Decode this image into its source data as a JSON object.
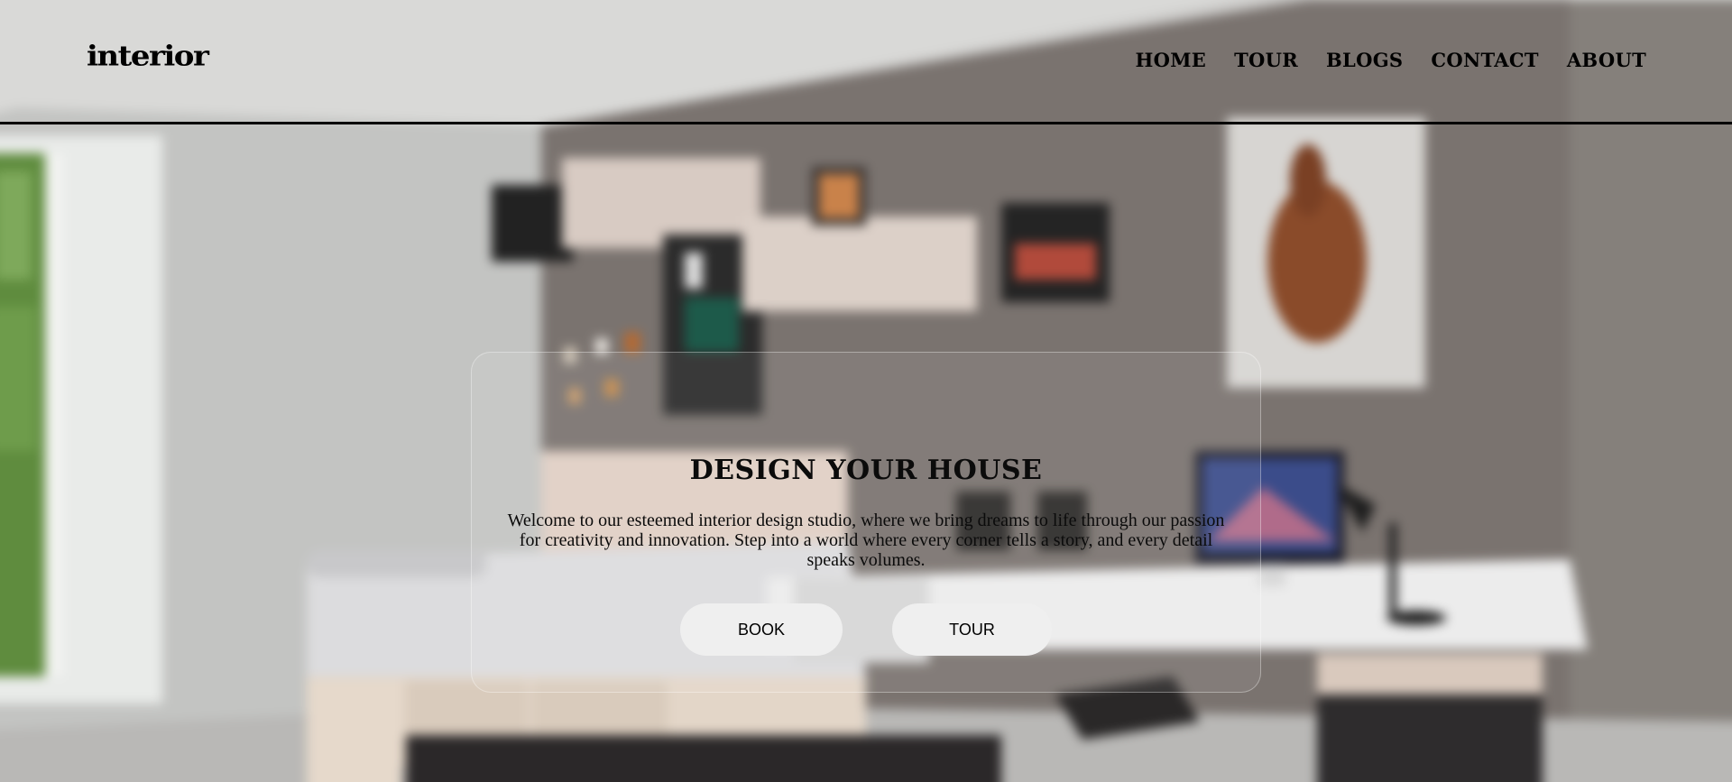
{
  "header": {
    "logo": "interior",
    "nav": [
      "HOME",
      "TOUR",
      "BLOGS",
      "CONTACT",
      "ABOUT"
    ]
  },
  "hero": {
    "title": "DESIGN YOUR HOUSE",
    "description": "Welcome to our esteemed interior design studio, where we bring dreams to life through our passion for creativity and innovation. Step into a world where every corner tells a story, and every detail speaks volumes.",
    "buttons": {
      "book": "BOOK",
      "tour": "TOUR"
    }
  },
  "background": {
    "image": "blurred-bedroom-photo"
  }
}
